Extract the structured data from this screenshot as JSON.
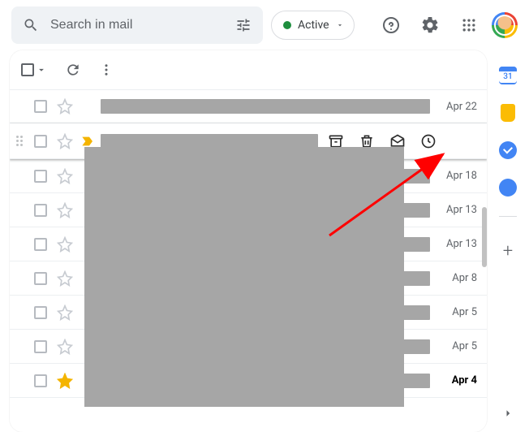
{
  "search": {
    "placeholder": "Search in mail"
  },
  "status": {
    "label": "Active"
  },
  "calendar": {
    "day": "31"
  },
  "rows": [
    {
      "date": "Apr 22",
      "starred": false,
      "important": false,
      "unread": false
    },
    {
      "date": "",
      "starred": false,
      "important": true,
      "unread": false,
      "hovered": true
    },
    {
      "date": "Apr 18",
      "starred": false,
      "important": false,
      "unread": false
    },
    {
      "date": "Apr 13",
      "starred": false,
      "important": false,
      "unread": false
    },
    {
      "date": "Apr 13",
      "starred": false,
      "important": false,
      "unread": false
    },
    {
      "date": "Apr 8",
      "starred": false,
      "important": false,
      "unread": false
    },
    {
      "date": "Apr 5",
      "starred": false,
      "important": false,
      "unread": false
    },
    {
      "date": "Apr 5",
      "starred": false,
      "important": false,
      "unread": false
    },
    {
      "date": "Apr 4",
      "starred": true,
      "important": false,
      "unread": true
    }
  ],
  "icons": {
    "archive": "archive-icon",
    "delete": "delete-icon",
    "mark_read": "mark-read-icon",
    "snooze": "snooze-icon"
  }
}
